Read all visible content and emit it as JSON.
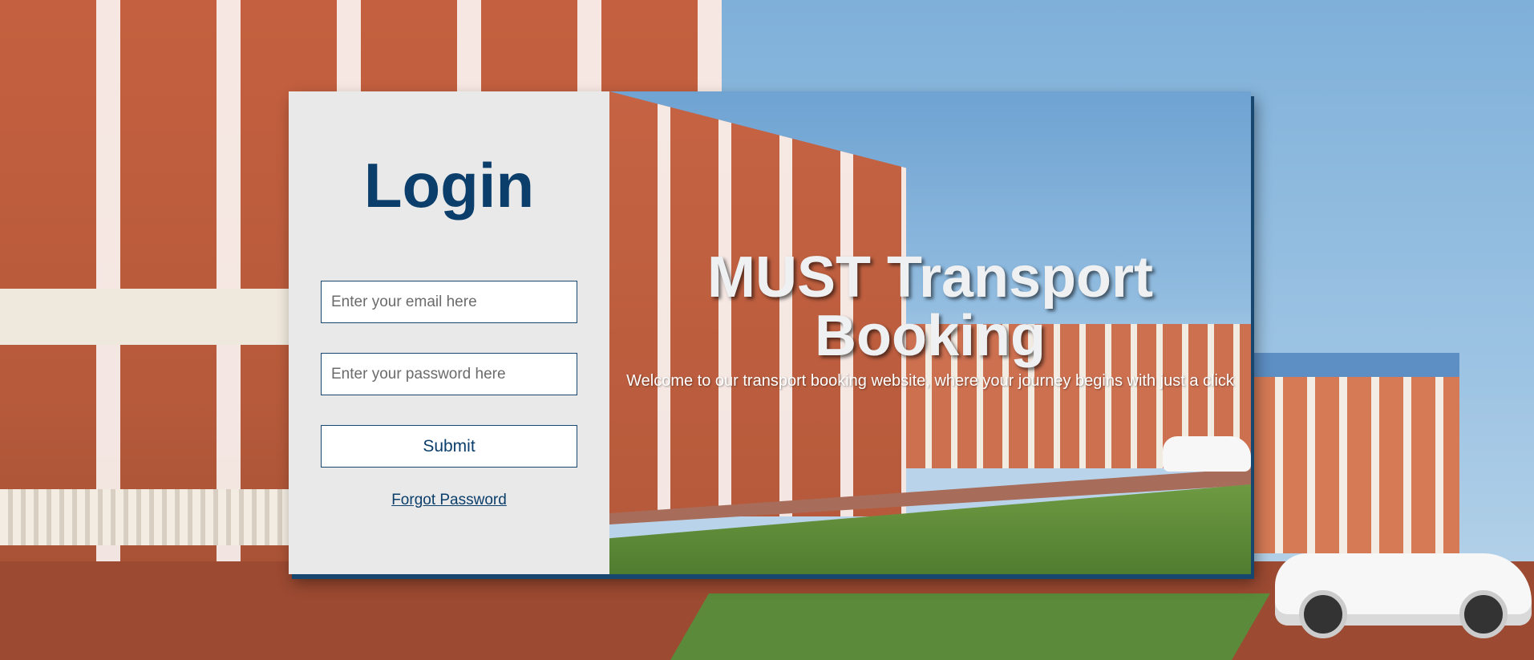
{
  "login": {
    "title": "Login",
    "email_placeholder": "Enter your email here",
    "password_placeholder": "Enter your password here",
    "submit_label": "Submit",
    "forgot_label": "Forgot Password"
  },
  "hero": {
    "title": "MUST Transport Booking",
    "subtitle": "Welcome to our transport booking website, where your journey begins with just a click"
  },
  "colors": {
    "brand": "#0b3e6b",
    "panel_bg": "#e9e9e9",
    "border": "#17466e"
  }
}
